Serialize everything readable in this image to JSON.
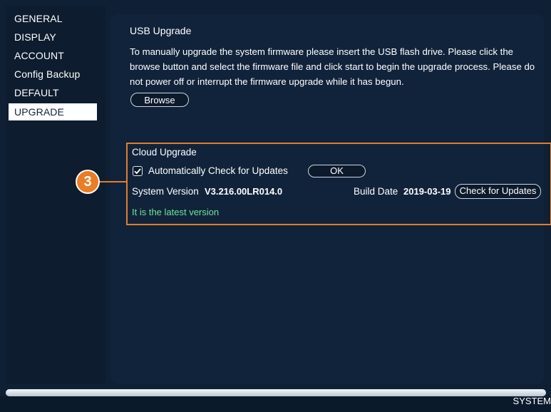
{
  "sidebar": {
    "items": [
      {
        "label": "GENERAL"
      },
      {
        "label": "DISPLAY"
      },
      {
        "label": "ACCOUNT"
      },
      {
        "label": "Config Backup"
      },
      {
        "label": "DEFAULT"
      },
      {
        "label": "UPGRADE",
        "active": true
      }
    ]
  },
  "usb": {
    "title": "USB Upgrade",
    "description": "To manually upgrade the system firmware please insert the USB flash drive. Please click the browse button and select the firmware file and click start to begin the upgrade process. Please do not power off or interrupt the firmware upgrade while it has begun.",
    "browse_label": "Browse"
  },
  "cloud": {
    "title": "Cloud Upgrade",
    "auto_check_label": "Automatically Check for Updates",
    "auto_check_checked": true,
    "ok_label": "OK",
    "system_version_label": "System Version",
    "system_version_value": "V3.216.00LR014.0",
    "build_date_label": "Build Date",
    "build_date_value": "2019-03-19",
    "check_updates_label": "Check for Updates",
    "status_text": "It is the latest version"
  },
  "callout": {
    "number": "3",
    "color": "#ea7d25"
  },
  "footer": {
    "system_label": "SYSTEM"
  },
  "colors": {
    "accent": "#e27d2e",
    "status_ok": "#6ee39a",
    "panel": "#11233b"
  }
}
